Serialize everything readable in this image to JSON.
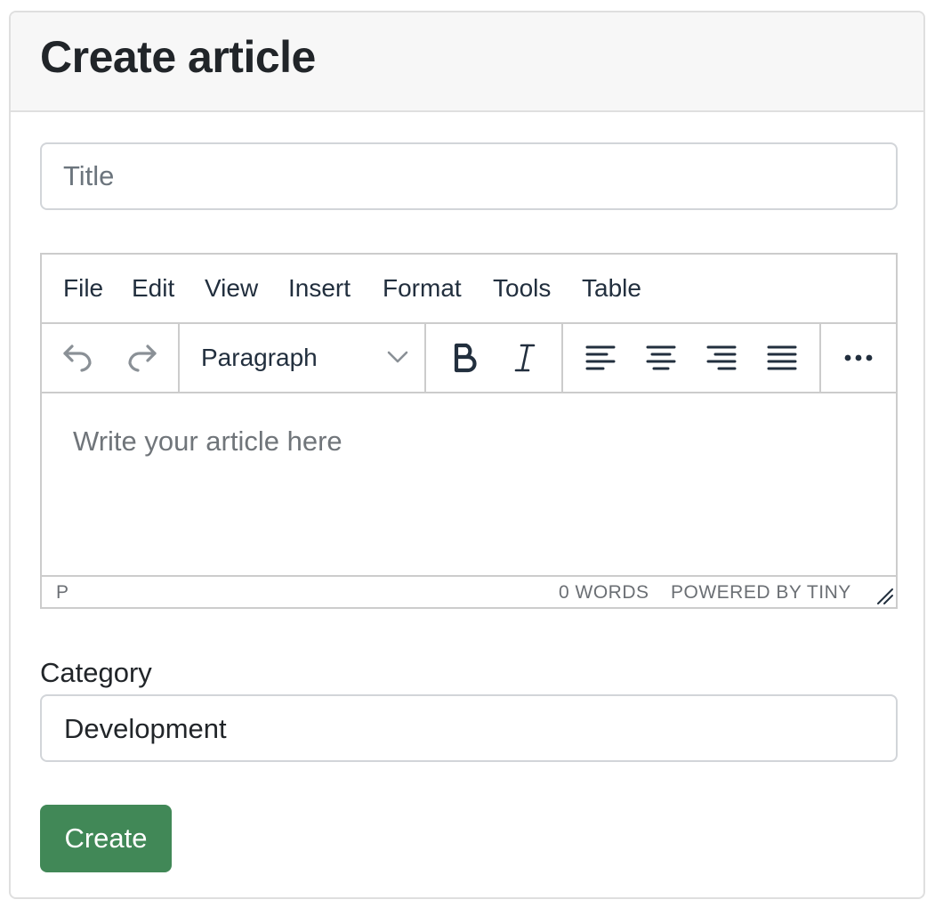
{
  "page": {
    "title": "Create article"
  },
  "form": {
    "title_placeholder": "Title",
    "title_value": "",
    "category_label": "Category",
    "category_value": "Development",
    "submit_label": "Create"
  },
  "editor": {
    "menu": [
      "File",
      "Edit",
      "View",
      "Insert",
      "Format",
      "Tools",
      "Table"
    ],
    "block_format": "Paragraph",
    "placeholder": "Write your article here",
    "status_path": "P",
    "word_count": "0 WORDS",
    "branding": "POWERED BY TINY",
    "toolbar_icons": [
      "undo-icon",
      "redo-icon",
      "bold-icon",
      "italic-icon",
      "align-left-icon",
      "align-center-icon",
      "align-right-icon",
      "align-justify-icon",
      "more-icon"
    ]
  },
  "colors": {
    "primary_button": "#418857",
    "header_bg": "#f7f7f7",
    "border": "#dfdfdf",
    "placeholder_text": "#6c757d",
    "icon_disabled": "#8a9096",
    "icon_active": "#222f3e"
  }
}
